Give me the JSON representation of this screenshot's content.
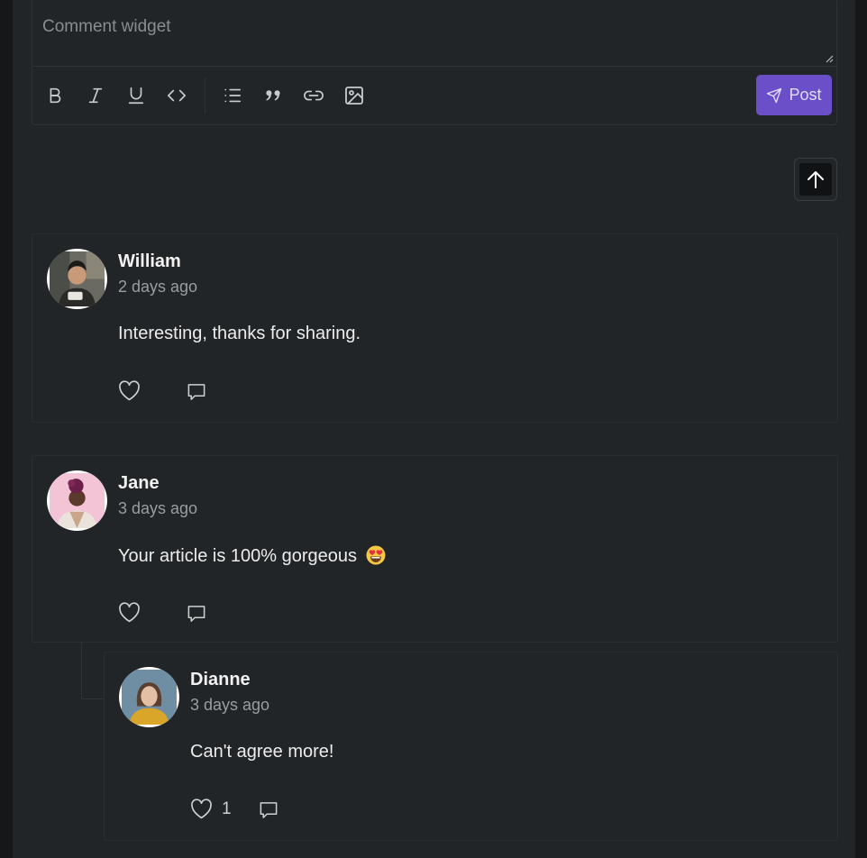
{
  "editor": {
    "placeholder": "Comment widget",
    "toolbar": {
      "bold_icon": "bold-icon",
      "italic_icon": "italic-icon",
      "underline_icon": "underline-icon",
      "code_icon": "code-icon",
      "list_icon": "list-icon",
      "quote_icon": "quote-icon",
      "link_icon": "link-icon",
      "image_icon": "image-icon"
    },
    "post_label": "Post",
    "post_color": "#6a4fc8"
  },
  "scroll_top_icon": "arrow-up-icon",
  "comments": [
    {
      "author": "William",
      "time": "2 days ago",
      "text": "Interesting, thanks for sharing.",
      "likes": ""
    },
    {
      "author": "Jane",
      "time": "3 days ago",
      "text": "Your article is 100% gorgeous",
      "emoji": "😍",
      "likes": ""
    }
  ],
  "replies": [
    {
      "author": "Dianne",
      "time": "3 days ago",
      "text": "Can't agree more!",
      "likes": "1"
    }
  ]
}
